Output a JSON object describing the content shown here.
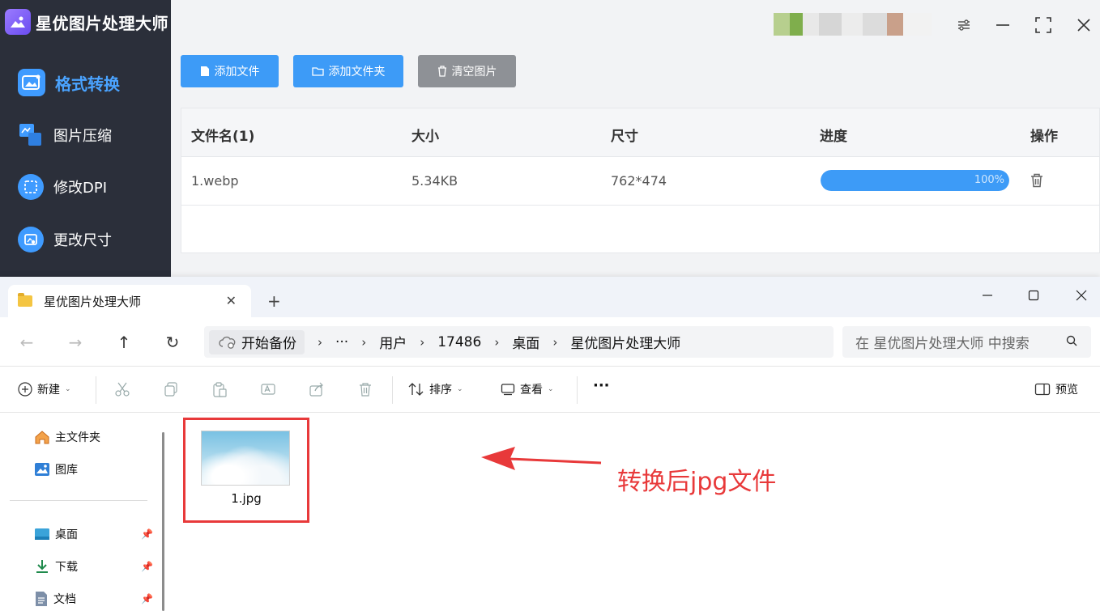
{
  "app": {
    "title": "星优图片处理大师",
    "nav": [
      {
        "label": "格式转换",
        "active": true
      },
      {
        "label": "图片压缩",
        "active": false
      },
      {
        "label": "修改DPI",
        "active": false
      },
      {
        "label": "更改尺寸",
        "active": false
      }
    ],
    "toolbar": {
      "add_file": "添加文件",
      "add_folder": "添加文件夹",
      "clear": "清空图片"
    },
    "table": {
      "headers": [
        "文件名(1)",
        "大小",
        "尺寸",
        "进度",
        "操作"
      ],
      "rows": [
        {
          "name": "1.webp",
          "size": "5.34KB",
          "dimensions": "762*474",
          "progress": 1.0,
          "progress_label": "100%"
        }
      ]
    },
    "colors": {
      "accent": "#3d9bf7",
      "sidebar": "#2b2f3a",
      "active_nav": "#4aa3ff"
    }
  },
  "explorer": {
    "tab_title": "星优图片处理大师",
    "address": {
      "backup_label": "开始备份",
      "ellipsis": "···",
      "crumbs": [
        "用户",
        "17486",
        "桌面",
        "星优图片处理大师"
      ]
    },
    "search_placeholder": "在 星优图片处理大师 中搜索",
    "commands": {
      "new": "新建",
      "sort": "排序",
      "view": "查看",
      "more": "···",
      "preview": "预览"
    },
    "sidebar": {
      "top": [
        {
          "label": "主文件夹",
          "icon": "home-icon"
        },
        {
          "label": "图库",
          "icon": "gallery-icon"
        }
      ],
      "pinned": [
        {
          "label": "桌面",
          "icon": "desktop-icon"
        },
        {
          "label": "下载",
          "icon": "download-icon"
        },
        {
          "label": "文档",
          "icon": "document-icon"
        }
      ]
    },
    "files": [
      {
        "name": "1.jpg"
      }
    ],
    "annotation": "转换后jpg文件",
    "annotation_color": "#e8393a"
  }
}
